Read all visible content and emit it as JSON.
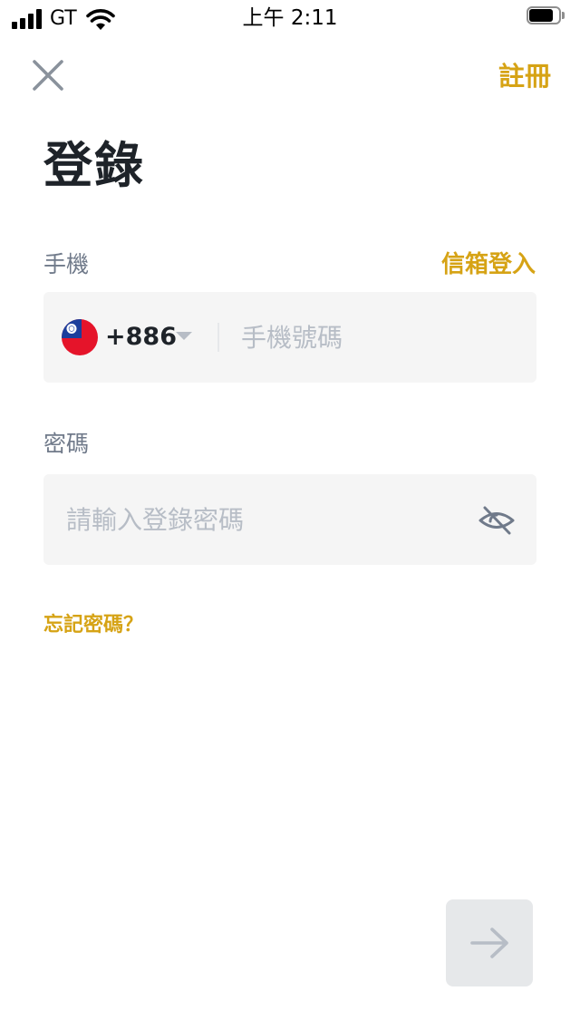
{
  "status_bar": {
    "carrier": "GT",
    "time": "上午 2:11"
  },
  "header": {
    "close_icon": "close-icon",
    "register_label": "註冊"
  },
  "title": "登錄",
  "phone": {
    "label": "手機",
    "switch_to_email_label": "信箱登入",
    "country_code": "+886",
    "placeholder": "手機號碼",
    "value": ""
  },
  "password": {
    "label": "密碼",
    "placeholder": "請輸入登錄密碼",
    "value": "",
    "visibility_icon": "eye-slash-icon"
  },
  "forgot_password_label": "忘記密碼？",
  "submit": {
    "icon": "arrow-right-icon",
    "enabled": false
  },
  "colors": {
    "accent": "#d6a315",
    "text_primary": "#1e2329",
    "text_secondary": "#707a8a",
    "placeholder": "#b7bdc6",
    "input_background": "#f5f5f5",
    "disabled_button": "#e6e8ea"
  }
}
